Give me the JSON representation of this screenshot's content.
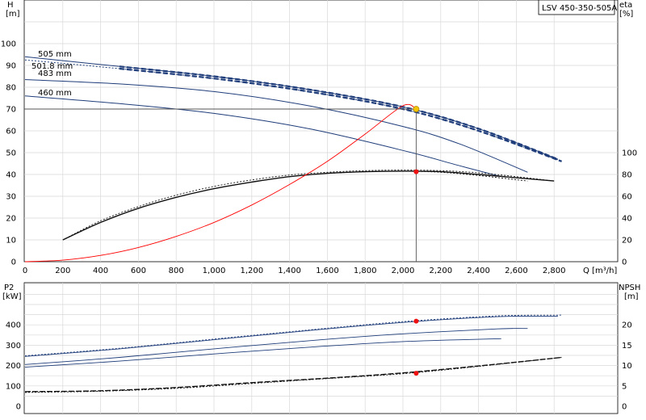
{
  "chart_data": [
    {
      "type": "line",
      "title": "LSV 450-350-505A",
      "xlabel": "Q [m³/h]",
      "ylabel_left": [
        "H",
        "[m]"
      ],
      "ylabel_right": [
        "eta",
        "[%]"
      ],
      "xlim": [
        0,
        2900
      ],
      "ylim_left": [
        0,
        110
      ],
      "ylim_right": [
        0,
        200
      ],
      "x_ticks": [
        "0",
        "200",
        "400",
        "600",
        "800",
        "1,000",
        "1,200",
        "1,400",
        "1,600",
        "1,800",
        "2,000",
        "2,200",
        "2,400",
        "2,600",
        "2,800"
      ],
      "x_tick_values": [
        0,
        200,
        400,
        600,
        800,
        1000,
        1200,
        1400,
        1600,
        1800,
        2000,
        2200,
        2400,
        2600,
        2800
      ],
      "y_ticks_left": [
        0,
        10,
        20,
        30,
        40,
        50,
        60,
        70,
        80,
        90,
        100
      ],
      "y_ticks_right": [
        0,
        20,
        40,
        60,
        80,
        100
      ],
      "grid": true,
      "head_curves": [
        {
          "name": "505 mm",
          "style": "solid",
          "x": [
            0,
            500,
            1000,
            1500,
            2000,
            2400,
            2820
          ],
          "y": [
            94,
            89.5,
            85,
            79,
            71,
            61,
            47
          ]
        },
        {
          "name": "501.8 mm",
          "style": "dotted",
          "x": [
            0,
            500,
            1000,
            1500,
            2000,
            2400,
            2840
          ],
          "y": [
            92.5,
            88.5,
            84,
            78,
            70,
            60,
            46
          ]
        },
        {
          "name": "483 mm",
          "style": "solid",
          "x": [
            0,
            500,
            1000,
            1500,
            2000,
            2300,
            2660
          ],
          "y": [
            83.5,
            81.5,
            78,
            71.5,
            62,
            54,
            41
          ]
        },
        {
          "name": "460 mm",
          "style": "solid",
          "x": [
            0,
            500,
            1000,
            1500,
            2000,
            2300,
            2520
          ],
          "y": [
            76,
            72.5,
            68,
            61,
            51,
            44,
            39
          ]
        }
      ],
      "efficiency_curves": [
        {
          "style": "solid",
          "x": [
            200,
            400,
            600,
            800,
            1000,
            1200,
            1400,
            1600,
            1800,
            2000,
            2200,
            2400,
            2600,
            2800
          ],
          "y": [
            20,
            36,
            49,
            59,
            67,
            73,
            78,
            81,
            82.5,
            83,
            82.5,
            80,
            77,
            74
          ]
        },
        {
          "style": "dotted",
          "x": [
            200,
            400,
            600,
            800,
            1000,
            1200,
            1400,
            1600,
            1800,
            2000,
            2200,
            2400,
            2600,
            2800
          ],
          "y": [
            20,
            37.5,
            50.5,
            61,
            69,
            75,
            79.5,
            82,
            83.5,
            84,
            83.5,
            81.5,
            78,
            74
          ]
        },
        {
          "style": "dotted",
          "x": [
            1600,
            1800,
            2000,
            2200,
            2400,
            2660
          ],
          "y": [
            81,
            82.5,
            83,
            82,
            79,
            74
          ]
        }
      ],
      "system_curve": {
        "color": "#ff0000",
        "x": [
          0,
          200,
          400,
          600,
          800,
          1000,
          1200,
          1400,
          1600,
          1800,
          2000,
          2070
        ],
        "y": [
          0,
          0.7,
          2.9,
          6.5,
          11.6,
          18,
          26,
          35.4,
          46,
          58.5,
          71.5,
          70
        ]
      },
      "duty_point": {
        "x": 2070,
        "y": 70
      },
      "efficiency_point": {
        "x": 2070,
        "eta": 82.5
      }
    },
    {
      "type": "line",
      "ylabel_left": [
        "P2",
        "[kW]"
      ],
      "ylabel_right": [
        "NPSH",
        "[m]"
      ],
      "xlim": [
        0,
        2900
      ],
      "ylim_left": [
        0,
        500
      ],
      "ylim_right": [
        0,
        25
      ],
      "y_ticks_left": [
        0,
        100,
        200,
        300,
        400
      ],
      "y_ticks_right": [
        0,
        5,
        10,
        15,
        20
      ],
      "grid": true,
      "power_curves": [
        {
          "style": "solid",
          "x": [
            0,
            500,
            1000,
            1500,
            2000,
            2500,
            2820
          ],
          "y": [
            245,
            282,
            327,
            372,
            412,
            440,
            442
          ]
        },
        {
          "style": "dotted",
          "x": [
            0,
            500,
            1000,
            1500,
            2000,
            2500,
            2840
          ],
          "y": [
            248,
            285,
            330,
            375,
            416,
            444,
            448
          ]
        },
        {
          "style": "solid",
          "x": [
            0,
            500,
            1000,
            1500,
            2000,
            2500,
            2660
          ],
          "y": [
            205,
            240,
            282,
            322,
            356,
            380,
            382
          ]
        },
        {
          "style": "solid",
          "x": [
            0,
            500,
            1000,
            1500,
            2000,
            2520
          ],
          "y": [
            192,
            222,
            257,
            290,
            318,
            332
          ]
        }
      ],
      "npsh_curves": [
        {
          "style": "solid",
          "x": [
            0,
            400,
            800,
            1200,
            1600,
            2000,
            2400,
            2840
          ],
          "y": [
            3.6,
            3.8,
            4.6,
            5.8,
            6.9,
            8.2,
            9.9,
            12
          ]
        },
        {
          "style": "dotted",
          "x": [
            0,
            400,
            800,
            1200,
            1600,
            2000,
            2400,
            2840
          ],
          "y": [
            3.4,
            3.7,
            4.4,
            5.6,
            6.8,
            8.0,
            9.8,
            12
          ]
        }
      ],
      "power_point": {
        "x": 2070,
        "y": 418
      },
      "npsh_point": {
        "x": 2070,
        "y": 8.1
      }
    }
  ]
}
